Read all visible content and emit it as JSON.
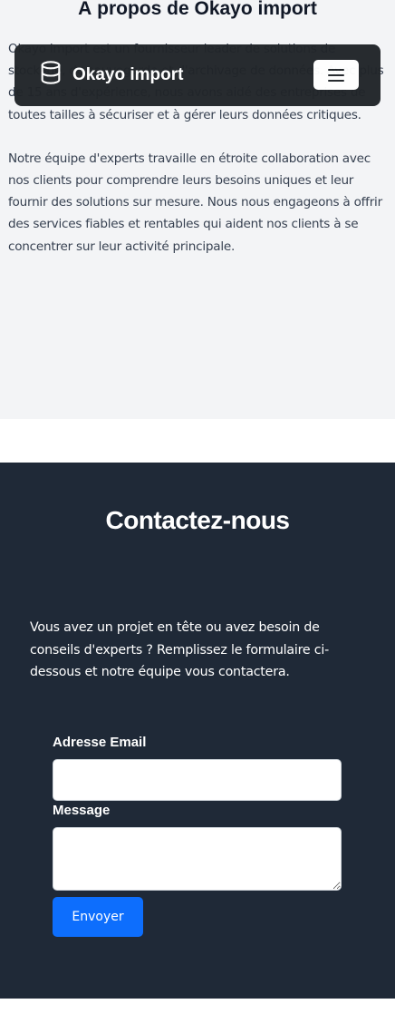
{
  "about": {
    "title": "À propos de Okayo import",
    "paragraphs": [
      "Okayo import est un fournisseur leader de solutions de stockage, de sauvegarde et d'archivage de données. Avec plus de 15 ans d'expérience, nous avons aidé des entreprises de toutes tailles à sécuriser et à gérer leurs données critiques.",
      "Notre équipe d'experts travaille en étroite collaboration avec nos clients pour comprendre leurs besoins uniques et leur fournir des solutions sur mesure. Nous nous engageons à offrir des services fiables et rentables qui aident nos clients à se concentrer sur leur activité principale."
    ]
  },
  "navbar": {
    "brand": "Okayo import",
    "brand_icon": "database-icon",
    "toggler_icon": "hamburger-icon"
  },
  "contact": {
    "title": "Contactez-nous",
    "intro": "Vous avez un projet en tête ou avez besoin de conseils d'experts ? Remplissez le formulaire ci-dessous et notre équipe vous contactera.",
    "email_label": "Adresse Email",
    "email_value": "",
    "message_label": "Message",
    "message_value": "",
    "submit_label": "Envoyer"
  },
  "colors": {
    "navbar_bg": "#212529",
    "contact_bg": "#1f2937",
    "about_bg": "#f3f4f6",
    "primary": "#0d6efd"
  }
}
